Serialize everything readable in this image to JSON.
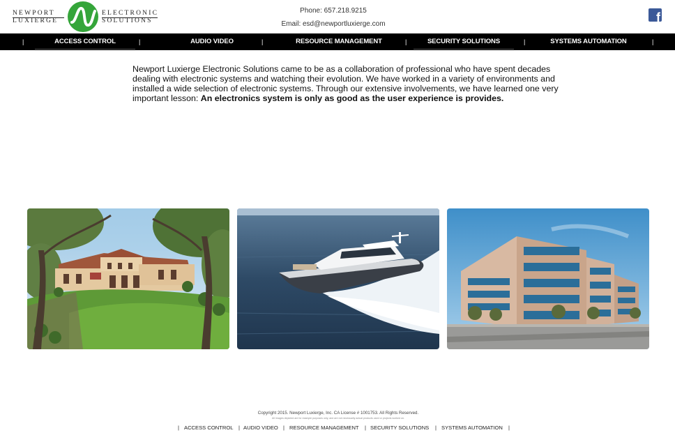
{
  "brand": {
    "line1": "Newport",
    "line2": "Luxierge",
    "line3": "Electronic",
    "line4": "Solutions",
    "accent_color": "#35a53a"
  },
  "contact": {
    "phone": "Phone: 657.218.9215",
    "email": "Email: esd@newportluxierge.com"
  },
  "social": {
    "icon": "facebook-icon",
    "glyph": "f",
    "color": "#3b5998"
  },
  "nav": {
    "separator": "|",
    "items": [
      {
        "label": "ACCESS CONTROL"
      },
      {
        "label": "AUDIO VIDEO"
      },
      {
        "label": "RESOURCE MANAGEMENT"
      },
      {
        "label": "SECURITY SOLUTIONS"
      },
      {
        "label": "SYSTEMS AUTOMATION"
      }
    ]
  },
  "intro": {
    "text": "Newport Luxierge Electronic Solutions came to be as a collaboration of professional who have spent decades dealing with electronic systems and watching their evolution. We have worked in a variety of environments and installed a wide selection of electronic systems. Through our extensive involvements, we have learned one very important lesson: ",
    "emphasis": "An electronics system is only as good as the user experience is provides."
  },
  "images": [
    {
      "name": "residence-photo"
    },
    {
      "name": "yacht-photo"
    },
    {
      "name": "office-building-photo"
    }
  ],
  "footer": {
    "copyright": "Copyright 2015. Newport Luxierge, Inc. CA License # 1001753. All Rights Reserved.",
    "fineprint": "All images depicted are for example purposes only, and are not necessarily actual products used or projects worked on.",
    "separator": "|",
    "links": [
      {
        "label": "ACCESS CONTROL"
      },
      {
        "label": "AUDIO VIDEO"
      },
      {
        "label": "RESOURCE MANAGEMENT"
      },
      {
        "label": "SECURITY SOLUTIONS"
      },
      {
        "label": "SYSTEMS AUTOMATION"
      }
    ]
  }
}
